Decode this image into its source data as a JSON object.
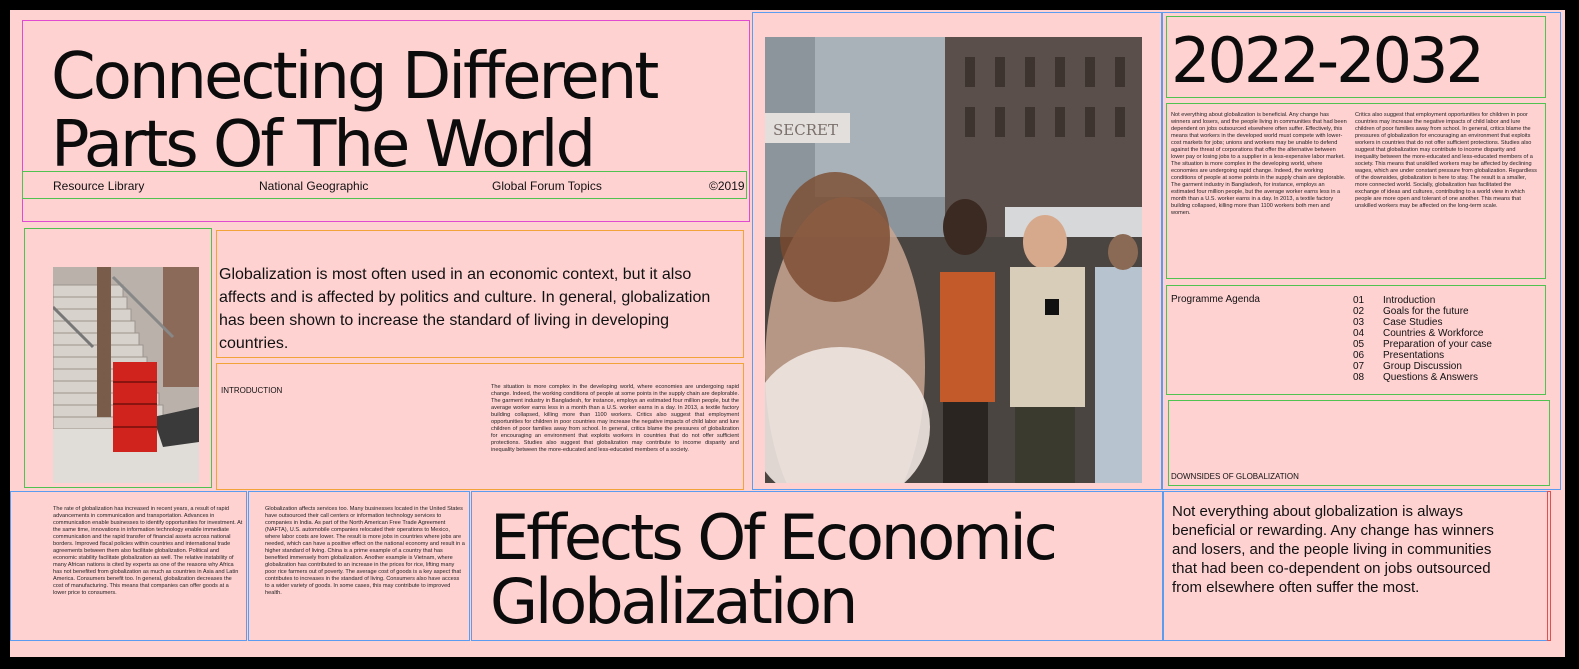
{
  "title": {
    "line1": "Connecting Different",
    "line2": "Parts Of The World"
  },
  "nav": {
    "item1": "Resource Library",
    "item2": "National Geographic",
    "item3": "Global Forum Topics",
    "item4": "©2019"
  },
  "lead": "Globalization is most often used in an economic context, but it also affects and is affected by politics and culture. In general, globalization has been shown to increase the standard of living in developing countries.",
  "intro": {
    "label": "INTRODUCTION",
    "body": "The situation is more complex in the developing world, where economies are undergoing rapid change. Indeed, the working conditions of people at some points in the supply chain are deplorable. The garment industry in Bangladesh, for instance, employs an estimated four million people, but the average worker earns less in a month than a U.S. worker earns in a day. In 2013, a textile factory building collapsed, killing more than 1100 workers. Critics also suggest that employment opportunities for children in poor countries may increase the negative impacts of child labor and lure children of poor families away from school. In general, critics blame the pressures of globalization for encouraging an environment that exploits workers in countries that do not offer sufficient protections. Studies also suggest that globalization may contribute to income disparity and inequality between the more-educated and less-educated members of a society."
  },
  "years": "2022-2032",
  "colA": "Not everything about globalization is beneficial. Any change has winners and losers, and the people living in communities that had been dependent on jobs outsourced elsewhere often suffer. Effectively, this means that workers in the developed world must compete with lower-cost markets for jobs; unions and workers may be unable to defend against the threat of corporations that offer the alternative between lower pay or losing jobs to a supplier in a less-expensive labor market. The situation is more complex in the developing world, where economies are undergoing rapid change. Indeed, the working conditions of people at some points in the supply chain are deplorable. The garment industry in Bangladesh, for instance, employs an estimated four million people, but the average worker earns less in a month than a U.S. worker earns in a day. In 2013, a textile factory building collapsed, killing more than 1100 workers both men and women.",
  "colB": "Critics also suggest that employment opportunities for children in poor countries may increase the negative impacts of child labor and lure children of poor families away from school. In general, critics blame the pressures of globalization for encouraging an environment that exploits workers in countries that do not offer sufficient protections. Studies also suggest that globalization may contribute to income disparity and inequality between the more-educated and less-educated members of a society. This means that unskilled workers may be affected by declining wages, which are under constant pressure from globalization. Regardless of the downsides, globalization is here to stay. The result is a smaller, more connected world. Socially, globalization has facilitated the exchange of ideas and cultures, contributing to a world view in which people are more open and tolerant of one another. This means that unskilled workers may be affected on the long-term scale.",
  "agenda": {
    "label": "Programme Agenda",
    "items": [
      {
        "num": "01",
        "text": "Introduction"
      },
      {
        "num": "02",
        "text": "Goals for the future"
      },
      {
        "num": "03",
        "text": "Case Studies"
      },
      {
        "num": "04",
        "text": "Countries & Workforce"
      },
      {
        "num": "05",
        "text": "Preparation of your case"
      },
      {
        "num": "06",
        "text": "Presentations"
      },
      {
        "num": "07",
        "text": "Group Discussion"
      },
      {
        "num": "08",
        "text": "Questions & Answers"
      }
    ]
  },
  "downsides_label": "DOWNSIDES OF GLOBALIZATION",
  "bottom": {
    "col1": "The rate of globalization has increased in recent years, a result of rapid advancements in communication and transportation. Advances in communication enable businesses to identify opportunities for investment. At the same time, innovations in information technology enable immediate communication and the rapid transfer of financial assets across national borders. Improved fiscal policies within countries and international trade agreements between them also facilitate globalization. Political and economic stability facilitate globalization as well. The relative instability of many African nations is cited by experts as one of the reasons why Africa has not benefited from globalization as much as countries in Asia and Latin America. Consumers benefit too. In general, globalization decreases the cost of manufacturing. This means that companies can offer goods at a lower price to consumers.",
    "col2": "Globalization affects services too. Many businesses located in the United States have outsourced their call centers or information technology services to companies in India. As part of the North American Free Trade Agreement (NAFTA), U.S. automobile companies relocated their operations to Mexico, where labor costs are lower. The result is more jobs in countries where jobs are needed, which can have a positive effect on the national economy and result in a higher standard of living. China is a prime example of a country that has benefited immensely from globalization. Another example is Vietnam, where globalization has contributed to an increase in the prices for rice, lifting many poor rice farmers out of poverty. The average cost of goods is a key aspect that contributes to increases in the standard of living. Consumers also have access to a wider variety of goods. In some cases, this may contribute to improved health.",
    "effects_line1": "Effects Of Economic",
    "effects_line2": "Globalization",
    "quote": "Not everything about globalization is always beneficial or rewarding. Any change has winners and losers, and the people living in communities that had been co-dependent on jobs outsourced from elsewhere often suffer the most."
  },
  "sign_text": "SECRET",
  "colors": {
    "background": "#ffd2d2",
    "frame": "#000000",
    "text": "#0c0c0c"
  }
}
